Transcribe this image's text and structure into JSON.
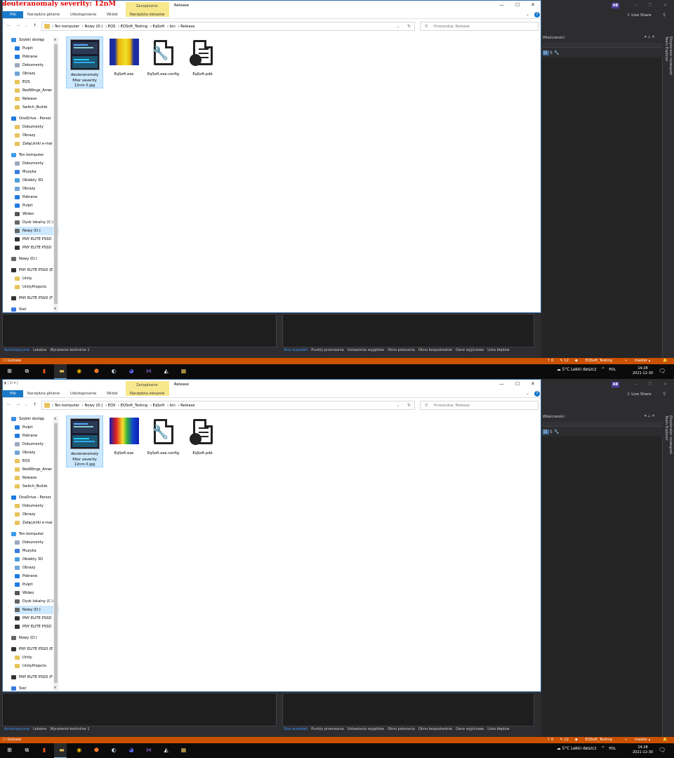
{
  "caption": "deuteranomaly severity: 12nM",
  "colors": {
    "vs_accent": "#ca5100",
    "explorer_blue": "#1979ca",
    "context_tab": "#f8e88d",
    "selection": "#cce8ff"
  },
  "explorer": {
    "window_title": "Release",
    "context_tab": "Zarządzanie",
    "ribbon_tabs": [
      "Plik",
      "Narzędzia główne",
      "Udostępnianie",
      "Widok",
      "Narzędzia obrazów"
    ],
    "breadcrumb": [
      "Ten komputer",
      "Nowy (D:)",
      "EQS",
      "EQSoft_Testing",
      "EqSoft",
      "bin",
      "Release"
    ],
    "search_placeholder": "Przeszukaj: Release",
    "nav_items": [
      {
        "label": "Szybki dostęp",
        "icon": "star-icon",
        "pin": false
      },
      {
        "label": "Pulpit",
        "icon": "desktop-icon",
        "pin": true
      },
      {
        "label": "Pobrane",
        "icon": "download-icon",
        "pin": true
      },
      {
        "label": "Dokumenty",
        "icon": "documents-icon",
        "pin": true
      },
      {
        "label": "Obrazy",
        "icon": "pictures-icon",
        "pin": true
      },
      {
        "label": "EQS",
        "icon": "folder-icon",
        "pin": false
      },
      {
        "label": "RedWings_Amer",
        "icon": "folder-icon",
        "pin": false
      },
      {
        "label": "Release",
        "icon": "folder-icon",
        "pin": false
      },
      {
        "label": "Switch_Builds",
        "icon": "folder-icon",
        "pin": false
      },
      {
        "label": "OneDrive - Persor",
        "icon": "cloud-icon",
        "pin": false
      },
      {
        "label": "Dokumenty",
        "icon": "folder-icon",
        "pin": false
      },
      {
        "label": "Obrazy",
        "icon": "folder-icon",
        "pin": false
      },
      {
        "label": "Załączniki e-mai",
        "icon": "folder-icon",
        "pin": false
      },
      {
        "label": "Ten komputer",
        "icon": "computer-icon",
        "pin": false
      },
      {
        "label": "Dokumenty",
        "icon": "documents-icon",
        "pin": false
      },
      {
        "label": "Muzyka",
        "icon": "music-icon",
        "pin": false
      },
      {
        "label": "Obiekty 3D",
        "icon": "3d-objects-icon",
        "pin": false
      },
      {
        "label": "Obrazy",
        "icon": "pictures-icon",
        "pin": false
      },
      {
        "label": "Pobrane",
        "icon": "download-icon",
        "pin": false
      },
      {
        "label": "Pulpit",
        "icon": "desktop-icon",
        "pin": false
      },
      {
        "label": "Wideo",
        "icon": "video-icon",
        "pin": false
      },
      {
        "label": "Dysk lokalny (C:)",
        "icon": "drive-icon",
        "pin": false
      },
      {
        "label": "Nowy (D:)",
        "icon": "drive-icon",
        "pin": false,
        "selected": true
      },
      {
        "label": "PNY ELITE PSSD",
        "icon": "usb-drive-icon",
        "pin": false
      },
      {
        "label": "PNY ELITE PSSD",
        "icon": "usb-drive-icon",
        "pin": false
      },
      {
        "label": "Nowy (D:)",
        "icon": "drive-icon",
        "pin": false
      },
      {
        "label": "PNY ELITE PSSD (E",
        "icon": "usb-drive-icon",
        "pin": false
      },
      {
        "label": "Unity",
        "icon": "folder-icon",
        "pin": false
      },
      {
        "label": "UnityProjects",
        "icon": "folder-icon",
        "pin": false
      },
      {
        "label": "PNY ELITE PSSD (F",
        "icon": "usb-drive-icon",
        "pin": false
      },
      {
        "label": "Sieć",
        "icon": "network-icon",
        "pin": false
      }
    ],
    "files": [
      {
        "name": "deuteranomaly filter severity 12nm 0.jpg",
        "icon": "image-thumbnail-icon",
        "selected": true
      },
      {
        "name": "EqSoft.exe",
        "icon": "exe-icon"
      },
      {
        "name": "EqSoft.exe.config",
        "icon": "config-file-icon"
      },
      {
        "name": "EqSoft.pdb",
        "icon": "pdb-file-icon"
      }
    ]
  },
  "vs": {
    "avatar": "AB",
    "live_share": "Live Share",
    "properties_title": "Właściwości",
    "side_tabs": [
      "Eksplorator rozwiązań",
      "Team Explorer"
    ],
    "left_tabs": [
      "Automatyczne",
      "Lokalne",
      "Wyrażenie kontrolne 1"
    ],
    "right_tabs": [
      "Stos wywołań",
      "Punkty przerwania",
      "Ustawienia wyjątków",
      "Okno polecenia",
      "Okno bezpośrednie",
      "Dane wyjściowe",
      "Lista błędów"
    ],
    "status_left": "Gotowe",
    "status_right": [
      "↑ 0",
      "✎ 12",
      "EQSoft_Testing",
      "master ▴"
    ]
  },
  "taskbar": {
    "apps": [
      {
        "name": "start-icon",
        "color": "#ffffff"
      },
      {
        "name": "task-view-icon",
        "color": "#ffffff"
      },
      {
        "name": "app-orange-icon",
        "color": "#e0561b"
      },
      {
        "name": "file-explorer-icon",
        "color": "#e8c25b"
      },
      {
        "name": "chrome-icon",
        "color": "#f4b400"
      },
      {
        "name": "blender-icon",
        "color": "#f5792a"
      },
      {
        "name": "steam-icon",
        "color": "#c7d5e0"
      },
      {
        "name": "discord-icon",
        "color": "#5865f2"
      },
      {
        "name": "visual-studio-icon",
        "color": "#865fc5"
      },
      {
        "name": "unity-icon",
        "color": "#ffffff"
      },
      {
        "name": "app-yellow-icon",
        "color": "#e8c25b"
      }
    ],
    "weather": "5°C  Lekki deszcz",
    "language": "POL",
    "time": "14:28",
    "date": "2021-12-30"
  }
}
